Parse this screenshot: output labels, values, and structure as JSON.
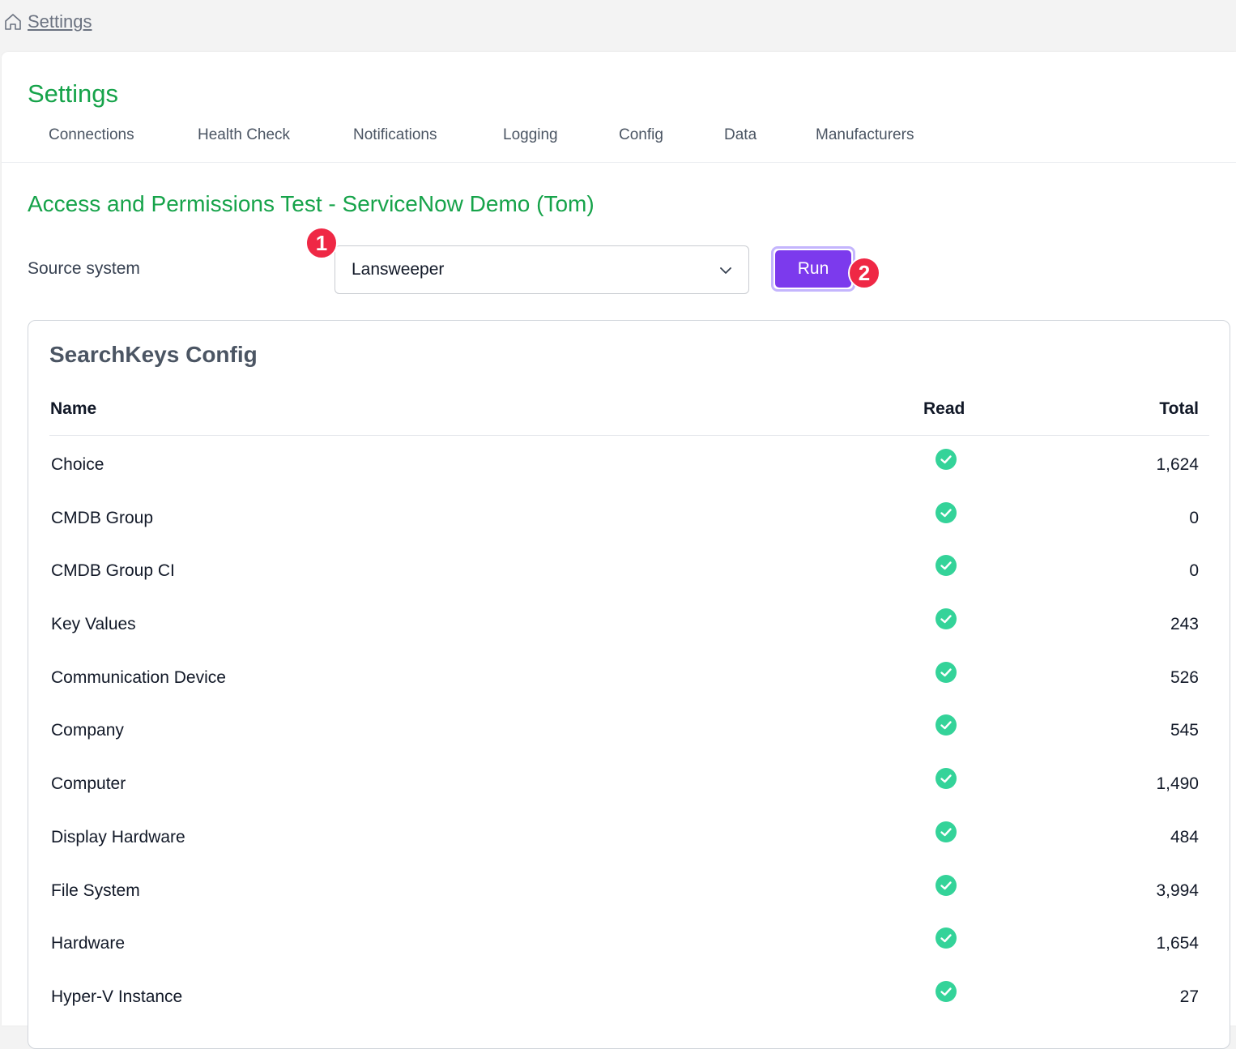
{
  "breadcrumb": {
    "label": "Settings",
    "icon": "home-icon"
  },
  "page": {
    "title": "Settings"
  },
  "tabs": [
    {
      "label": "Connections"
    },
    {
      "label": "Health Check"
    },
    {
      "label": "Notifications"
    },
    {
      "label": "Logging"
    },
    {
      "label": "Config"
    },
    {
      "label": "Data"
    },
    {
      "label": "Manufacturers"
    }
  ],
  "section": {
    "title": "Access and Permissions Test - ServiceNow Demo (Tom)"
  },
  "source": {
    "label": "Source system",
    "selected": "Lansweeper"
  },
  "run": {
    "label": "Run"
  },
  "annotations": {
    "first": "1",
    "second": "2"
  },
  "card": {
    "title": "SearchKeys Config",
    "columns": {
      "name": "Name",
      "read": "Read",
      "total": "Total"
    },
    "rows": [
      {
        "name": "Choice",
        "total": "1,624"
      },
      {
        "name": "CMDB Group",
        "total": "0"
      },
      {
        "name": "CMDB Group CI",
        "total": "0"
      },
      {
        "name": "Key Values",
        "total": "243"
      },
      {
        "name": "Communication Device",
        "total": "526"
      },
      {
        "name": "Company",
        "total": "545"
      },
      {
        "name": "Computer",
        "total": "1,490"
      },
      {
        "name": "Display Hardware",
        "total": "484"
      },
      {
        "name": "File System",
        "total": "3,994"
      },
      {
        "name": "Hardware",
        "total": "1,654"
      },
      {
        "name": "Hyper-V Instance",
        "total": "27"
      }
    ]
  },
  "colors": {
    "accent_green": "#16a34a",
    "run_purple": "#7c3aed",
    "badge_red": "#ef2845",
    "check_green": "#34d399"
  }
}
